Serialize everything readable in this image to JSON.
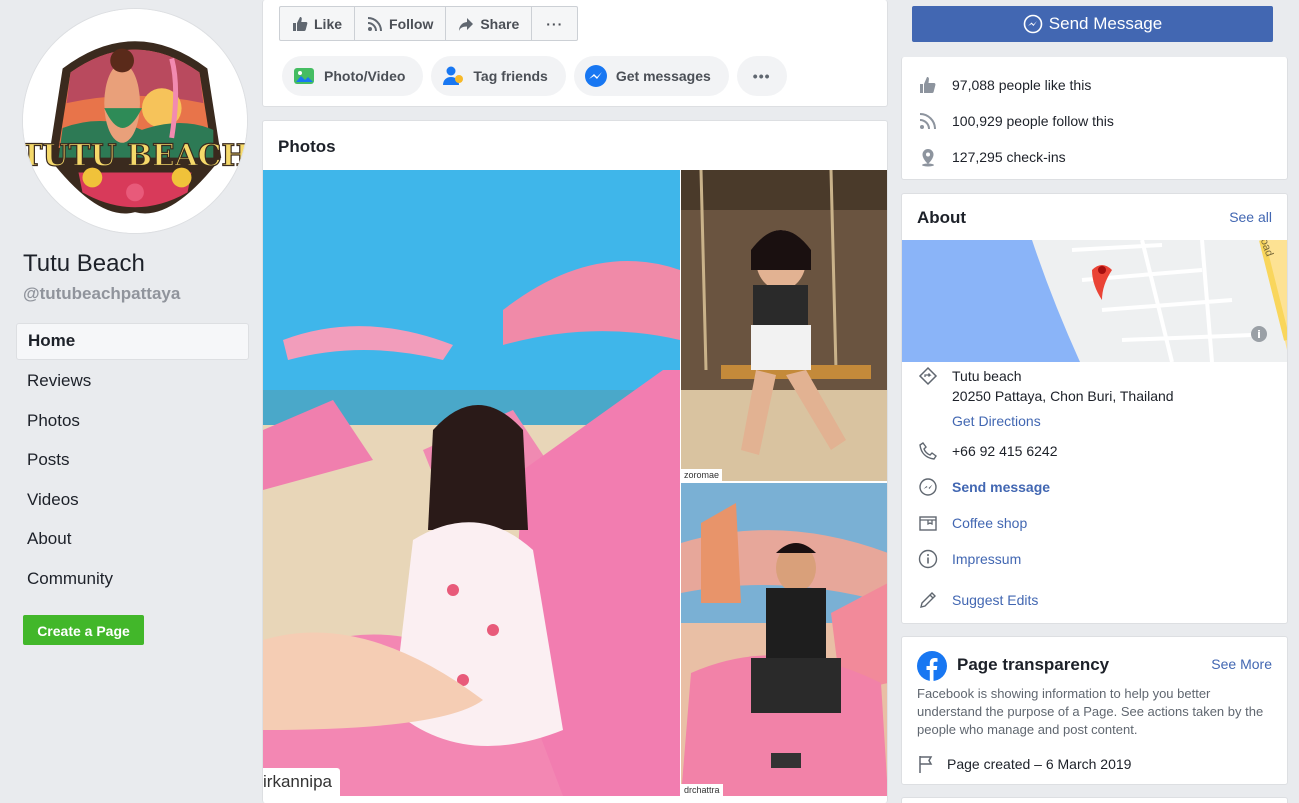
{
  "page": {
    "name": "Tutu Beach",
    "handle": "@tutubeachpattaya",
    "logo_text": "TUTU BEACH"
  },
  "nav": {
    "items": [
      "Home",
      "Reviews",
      "Photos",
      "Posts",
      "Videos",
      "About",
      "Community"
    ],
    "active": "Home"
  },
  "create_page_label": "Create a Page",
  "actions": {
    "like": "Like",
    "follow": "Follow",
    "share": "Share",
    "more": "···"
  },
  "composer": {
    "photo_video": "Photo/Video",
    "tag_friends": "Tag friends",
    "get_messages": "Get messages",
    "more": "•••"
  },
  "photos": {
    "title": "Photos",
    "items": [
      {
        "credit": "irkannipa"
      },
      {
        "credit": "zoromae"
      },
      {
        "credit": "drchattra"
      }
    ]
  },
  "send_message_label": "Send Message",
  "stats": {
    "likes": "97,088 people like this",
    "follows": "100,929 people follow this",
    "checkins": "127,295 check-ins"
  },
  "about": {
    "title": "About",
    "see_all": "See all",
    "map_road_label": "Road",
    "address_line1": "Tutu beach",
    "address_line2": "20250 Pattaya, Chon Buri, Thailand",
    "directions": "Get Directions",
    "phone": "+66 92 415 6242",
    "send_message": "Send message",
    "category": "Coffee shop",
    "impressum": "Impressum",
    "suggest_edits": "Suggest Edits"
  },
  "transparency": {
    "title": "Page transparency",
    "see_more": "See More",
    "text": "Facebook is showing information to help you better understand the purpose of a Page. See actions taken by the people who manage and post content.",
    "created": "Page created – 6 March 2019"
  },
  "colors": {
    "fb_blue": "#4267b2",
    "create_green": "#42b72a",
    "map_water": "#8ab4f8",
    "map_pin": "#ea4335"
  }
}
